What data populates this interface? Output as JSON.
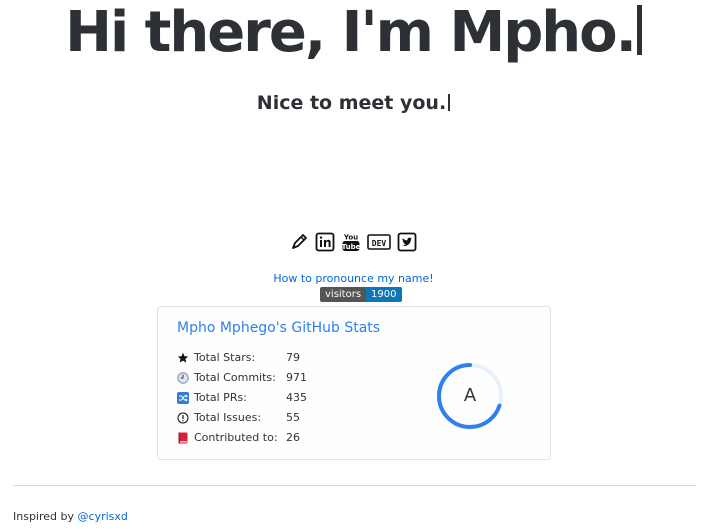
{
  "header": {
    "headline": "Hi there, I'm Mpho.",
    "subline": "Nice to meet you."
  },
  "social": [
    {
      "name": "pencil-icon",
      "label": "blog"
    },
    {
      "name": "linkedin-icon",
      "label": "in"
    },
    {
      "name": "youtube-icon",
      "label": "YouTube"
    },
    {
      "name": "dev-icon",
      "label": "DEV"
    },
    {
      "name": "twitter-icon",
      "label": "twitter"
    }
  ],
  "pronounce_link": "How to pronounce my name!",
  "visitors_badge": {
    "label": "visitors",
    "count": "1900"
  },
  "stats_card": {
    "title": "Mpho Mphego's GitHub Stats",
    "rows": [
      {
        "icon": "star-icon",
        "label": "Total Stars:",
        "value": "79"
      },
      {
        "icon": "clock-icon",
        "label": "Total Commits:",
        "value": "971"
      },
      {
        "icon": "pull-request-icon",
        "label": "Total PRs:",
        "value": "435"
      },
      {
        "icon": "issue-icon",
        "label": "Total Issues:",
        "value": "55"
      },
      {
        "icon": "book-icon",
        "label": "Contributed to:",
        "value": "26"
      }
    ],
    "rank": "A",
    "rank_progress": 0.7,
    "accent_color": "#2f80ed"
  },
  "footer": {
    "prefix": "Inspired by ",
    "link": "@cyrisxd"
  }
}
